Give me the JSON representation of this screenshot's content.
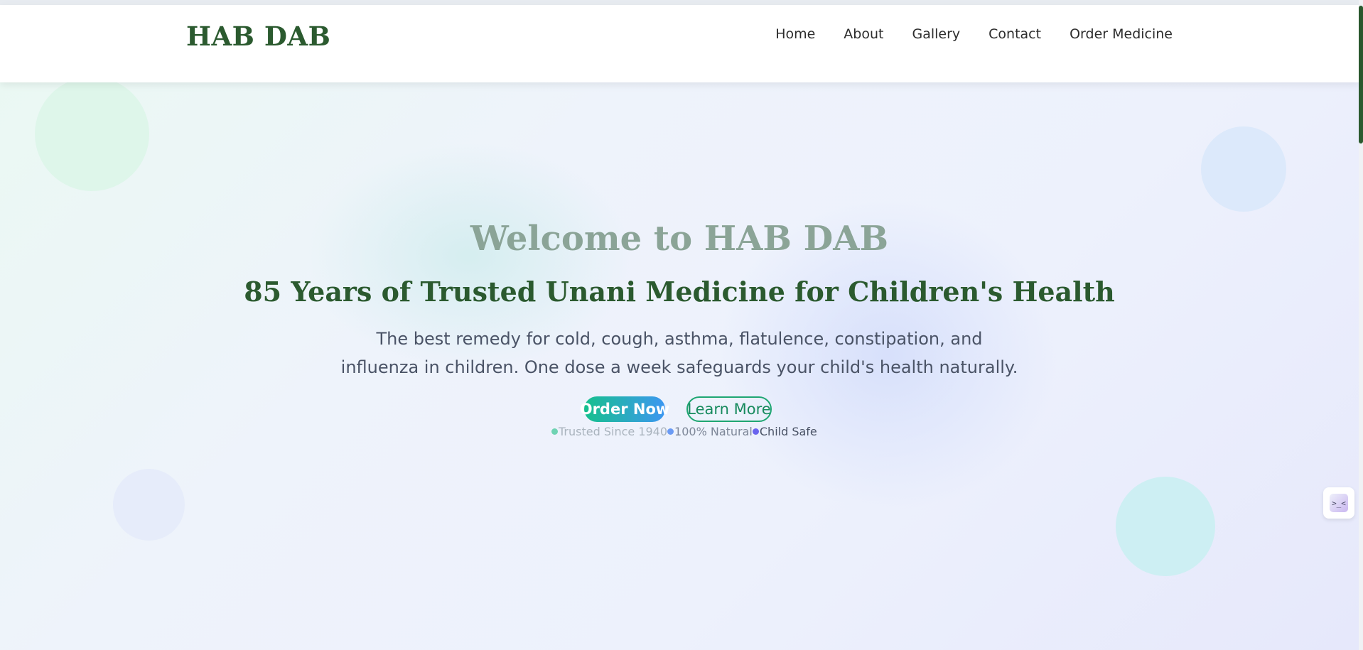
{
  "header": {
    "brand": "HAB DAB",
    "nav": [
      {
        "label": "Home"
      },
      {
        "label": "About"
      },
      {
        "label": "Gallery"
      },
      {
        "label": "Contact"
      },
      {
        "label": "Order Medicine"
      }
    ]
  },
  "hero": {
    "title": "Welcome to HAB DAB",
    "subtitle": "85 Years of Trusted Unani Medicine for Children's Health",
    "description": "The best remedy for cold, cough, asthma, flatulence, constipation, and influenza in children. One dose a week safeguards your child's health naturally.",
    "primary_button": "Order Now",
    "secondary_button": "Learn More",
    "badges": [
      {
        "label": "Trusted Since 1940",
        "dot_color": "#6fd3b3"
      },
      {
        "label": "100% Natural",
        "dot_color": "#6b9bf4"
      },
      {
        "label": "Child Safe",
        "dot_color": "#6a64ee"
      }
    ]
  },
  "side_widget": {
    "icon": "chat-widget-icon",
    "glyph": ">_<"
  },
  "colors": {
    "brand": "#2b5a2f",
    "accent_green": "#16c08d",
    "accent_blue": "#3d97f1"
  }
}
